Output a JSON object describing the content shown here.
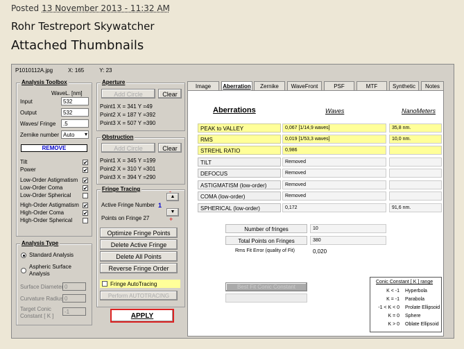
{
  "post": {
    "posted_label": "Posted",
    "date": "13 November 2013 - 11:32 AM",
    "title": "Rohr Testreport Skywatcher",
    "thumbs": "Attached Thumbnails"
  },
  "app": {
    "file": "P1010112A.jpg",
    "x": "X: 165",
    "y": "Y: 23"
  },
  "toolbox": {
    "title": "Analysis Toolbox",
    "wavel_label": "WaveL. [nm]",
    "input_label": "Input",
    "input_value": "532",
    "output_label": "Output",
    "output_value": "532",
    "waves_label": "Waves/ Fringe",
    "waves_value": ".5",
    "zernike_label": "Zernike number",
    "zernike_value": "Auto",
    "remove": "REMOVE",
    "checks": [
      {
        "label": "Tilt",
        "checked": "✔"
      },
      {
        "label": "Power",
        "checked": "✔"
      },
      {
        "label": "Low-Order  Astigmatism",
        "checked": "✔"
      },
      {
        "label": "Low-Order  Coma",
        "checked": "✔"
      },
      {
        "label": "Low-Order  Spherical",
        "checked": ""
      },
      {
        "label": "High-Order  Astigmatism",
        "checked": "✔"
      },
      {
        "label": "High-Order  Coma",
        "checked": "✔"
      },
      {
        "label": "High-Order  Spherical",
        "checked": ""
      }
    ]
  },
  "analysis_type": {
    "title": "Analysis Type",
    "std": "Standard Analysis",
    "asph": "Aspheric  Surface Analysis",
    "surf_diam": "Surface Diameter",
    "surf_diam_val": "0",
    "curv": "Curvature Radius",
    "curv_val": "0",
    "conic": "Target Conic Constant [ K ]",
    "conic_val": "-1"
  },
  "aperture": {
    "title": "Aperture",
    "add": "Add Circle",
    "clear": "Clear",
    "p1": "Point1  X =   341   Y =49",
    "p2": "Point2  X =   187   Y =392",
    "p3": "Point3  X =   507   Y =390"
  },
  "obstruction": {
    "title": "Obstruction",
    "add": "Add Circle",
    "clear": "Clear",
    "p1": "Point1  X =   345   Y =199",
    "p2": "Point2  X =   310   Y =301",
    "p3": "Point3  X =   394   Y =290"
  },
  "fringe": {
    "title": "Fringe Tracing",
    "active_label": "Active Fringe Number",
    "active_val": "1",
    "points": "Points on  Fringe 27",
    "optimize": "Optimize Fringe Points",
    "delete_active": "Delete Active Fringe",
    "delete_all": "Delete  All  Points",
    "reverse": "Reverse  Fringe Order",
    "auto": "Fringe AutoTracing",
    "perform": "Perform  AUTOTRACING",
    "apply": "APPLY"
  },
  "tabs": [
    "Image",
    "Aberration",
    "Zernike",
    "WaveFront",
    "PSF",
    "MTF",
    "Synthetic",
    "Notes"
  ],
  "aberr": {
    "heading": "Aberrations",
    "waves": "Waves",
    "nano": "NanoMeters",
    "rows": [
      {
        "name": "PEAK to VALLEY",
        "val": "0,067",
        "extra": "[1/14,9 waves]",
        "nm": "35,8  nm."
      },
      {
        "name": "RMS",
        "val": "0,019",
        "extra": "[1/53,3 waves]",
        "nm": "10,0  nm."
      },
      {
        "name": "STREHL   RATIO",
        "val": "0,986",
        "extra": "",
        "nm": ""
      },
      {
        "name": "TILT",
        "val": "Removed",
        "extra": "",
        "nm": ""
      },
      {
        "name": "DEFOCUS",
        "val": "Removed",
        "extra": "",
        "nm": ""
      },
      {
        "name": "ASTIGMATISM  (low-order)",
        "val": "Removed",
        "extra": "",
        "nm": ""
      },
      {
        "name": "COMA          (low-order)",
        "val": "Removed",
        "extra": "",
        "nm": ""
      },
      {
        "name": "SPHERICAL      (low-order)",
        "val": "0,172",
        "extra": "",
        "nm": "91,6  nm."
      }
    ],
    "nfringes_label": "Number of fringes",
    "nfringes": "10",
    "tpoints_label": "Total  Points on Fringes",
    "tpoints": "380",
    "rms_fit_label": "Rms Fit Error  (quality of Fit)",
    "rms_fit": "0,020",
    "best_fit": "Best Fit Conic Constant"
  },
  "conic": {
    "title": "Conic Constant [ K ]  range",
    "rows": [
      {
        "k": "K < -1",
        "n": "Hyperbola"
      },
      {
        "k": "K = -1",
        "n": "Parabola"
      },
      {
        "k": "-1 < K < 0",
        "n": "Prolate Ellipsoid"
      },
      {
        "k": "K =  0",
        "n": "Sphere"
      },
      {
        "k": "K >  0",
        "n": "Oblate Ellipsoid"
      }
    ]
  }
}
